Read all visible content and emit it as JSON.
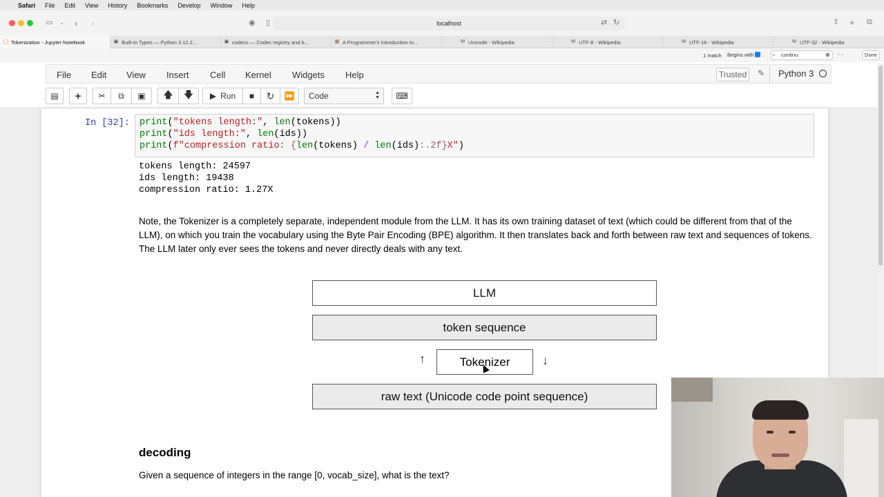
{
  "menubar": {
    "app": "Safari",
    "items": [
      "File",
      "Edit",
      "View",
      "History",
      "Bookmarks",
      "Develop",
      "Window",
      "Help"
    ]
  },
  "browser": {
    "url": "localhost",
    "tabs": [
      {
        "label": "Tokenization - Jupyter Notebook",
        "icon": "jupyter-icon",
        "active": true
      },
      {
        "label": "Built-in Types — Python 3.12.2...",
        "icon": "python-icon"
      },
      {
        "label": "codecs — Codec registry and b...",
        "icon": "python-icon"
      },
      {
        "label": "A Programmer's Introduction to...",
        "icon": "page-icon"
      },
      {
        "label": "Unicode - Wikipedia",
        "icon": "wikipedia-icon"
      },
      {
        "label": "UTF-8 - Wikipedia",
        "icon": "wikipedia-icon"
      },
      {
        "label": "UTF-16 - Wikipedia",
        "icon": "wikipedia-icon"
      },
      {
        "label": "UTF-32 - Wikipedia",
        "icon": "wikipedia-icon"
      }
    ],
    "find": {
      "match_count": "1 match",
      "mode": "Begins with",
      "query": "continu",
      "done_label": "Done"
    }
  },
  "jupyter": {
    "menu": [
      "File",
      "Edit",
      "View",
      "Insert",
      "Cell",
      "Kernel",
      "Widgets",
      "Help"
    ],
    "trusted": "Trusted",
    "kernel": "Python 3",
    "run_label": "Run",
    "cell_type": "Code"
  },
  "cell": {
    "prompt": "In [32]:",
    "output": [
      "tokens length: 24597",
      "ids length: 19438",
      "compression ratio: 1.27X"
    ]
  },
  "markdown": {
    "note": "Note, the Tokenizer is a completely separate, independent module from the LLM. It has its own training dataset of text (which could be different from that of the LLM), on which you train the vocabulary using the Byte Pair Encoding (BPE) algorithm. It then translates back and forth between raw text and sequences of tokens. The LLM later only ever sees the tokens and never directly deals with any text.",
    "diagram": {
      "llm": "LLM",
      "token_sequence": "token sequence",
      "tokenizer": "Tokenizer",
      "raw_text": "raw text (Unicode code point sequence)"
    },
    "heading": "decoding",
    "question": "Given a sequence of integers in the range [0, vocab_size], what is the text?"
  }
}
